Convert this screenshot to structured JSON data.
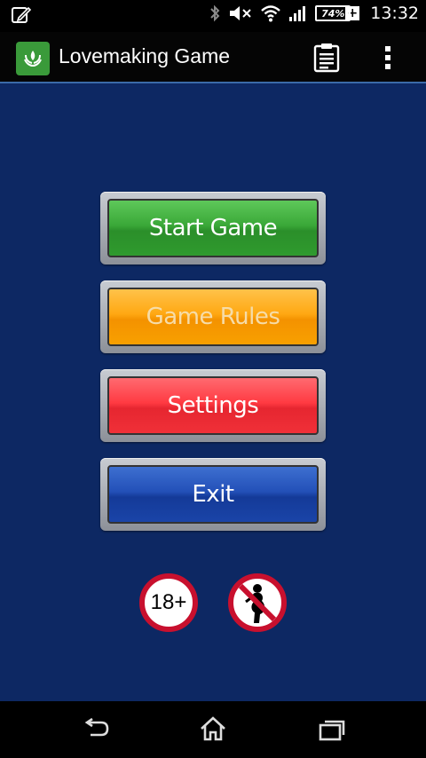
{
  "status_bar": {
    "time": "13:32",
    "battery_percent": "74%",
    "icons": [
      "edit-notification-icon",
      "bluetooth-icon",
      "mute-icon",
      "wifi-icon",
      "signal-icon",
      "battery-charging-icon"
    ]
  },
  "action_bar": {
    "title": "Lovemaking Game",
    "icons": [
      "app-icon",
      "clipboard-icon",
      "overflow-menu-icon"
    ]
  },
  "menu": {
    "start_label": "Start Game",
    "rules_label": "Game Rules",
    "settings_label": "Settings",
    "exit_label": "Exit"
  },
  "badges": {
    "age_label": "18+",
    "second": "no-pregnant-icon"
  },
  "nav_bar": {
    "icons": [
      "back-icon",
      "home-icon",
      "recents-icon"
    ]
  }
}
